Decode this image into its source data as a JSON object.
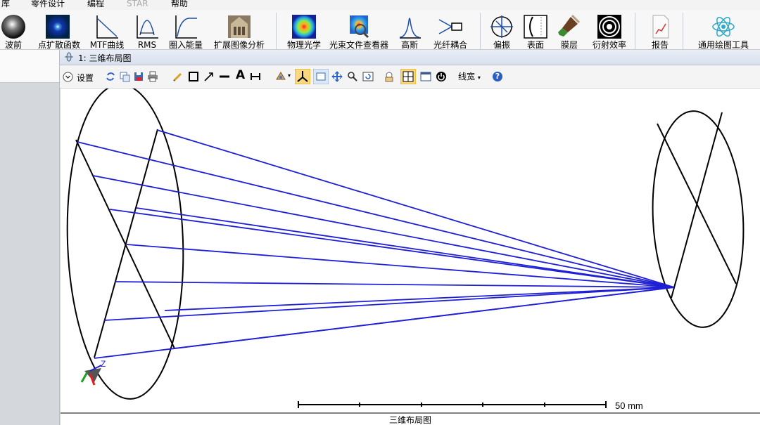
{
  "menu": {
    "items": [
      "库",
      "零件设计",
      "编程",
      "STAR",
      "帮助"
    ]
  },
  "ribbon": {
    "buttons": {
      "wavefront": "波前",
      "psf": "点扩散函数",
      "mtf": "MTF曲线",
      "rms": "RMS",
      "encircled": "圈入能量",
      "extended": "扩展图像分析",
      "physical": "物理光学",
      "beamfile": "光束文件查看器",
      "gauss": "高斯",
      "fiber": "光纤耦合",
      "polar": "偏振",
      "surface": "表面",
      "coating": "膜层",
      "diffraction": "衍射效率",
      "report": "报告",
      "universal": "通用绘图工具"
    },
    "dropdown_arrow": "▾",
    "icons": [
      "wavefront-icon",
      "psf-icon",
      "mtf-icon",
      "rms-icon",
      "encircled-energy-icon",
      "extended-image-icon",
      "physical-optics-icon",
      "beam-file-viewer-icon",
      "gaussian-icon",
      "fiber-coupling-icon",
      "polarization-icon",
      "surface-icon",
      "coating-icon",
      "diffraction-icon",
      "report-icon",
      "universal-plot-icon"
    ]
  },
  "window": {
    "title": "1: 三维布局图"
  },
  "toolbar": {
    "settings_label": "设置",
    "linewidth_label": "线宽",
    "help_glyph": "?",
    "text_glyph": "A",
    "icons": [
      "refresh-icon",
      "copy-icon",
      "save-icon",
      "print-icon",
      "pencil-icon",
      "rectangle-icon",
      "arrow-icon",
      "line-icon",
      "text-icon",
      "dimension-icon",
      "rotate-view-icon",
      "axes-icon",
      "fit-icon",
      "pan-icon",
      "zoom-icon",
      "reset-view-icon",
      "lock-icon",
      "tile-icon",
      "window-icon",
      "power-icon",
      "help-icon"
    ]
  },
  "plot": {
    "scale_label": "50 mm",
    "axis_label_z": "Z",
    "caption": "三维布局图",
    "ray_color": "#1f1fd6",
    "colors": {
      "accent": "#1f1fd6",
      "outline": "#000000"
    }
  }
}
